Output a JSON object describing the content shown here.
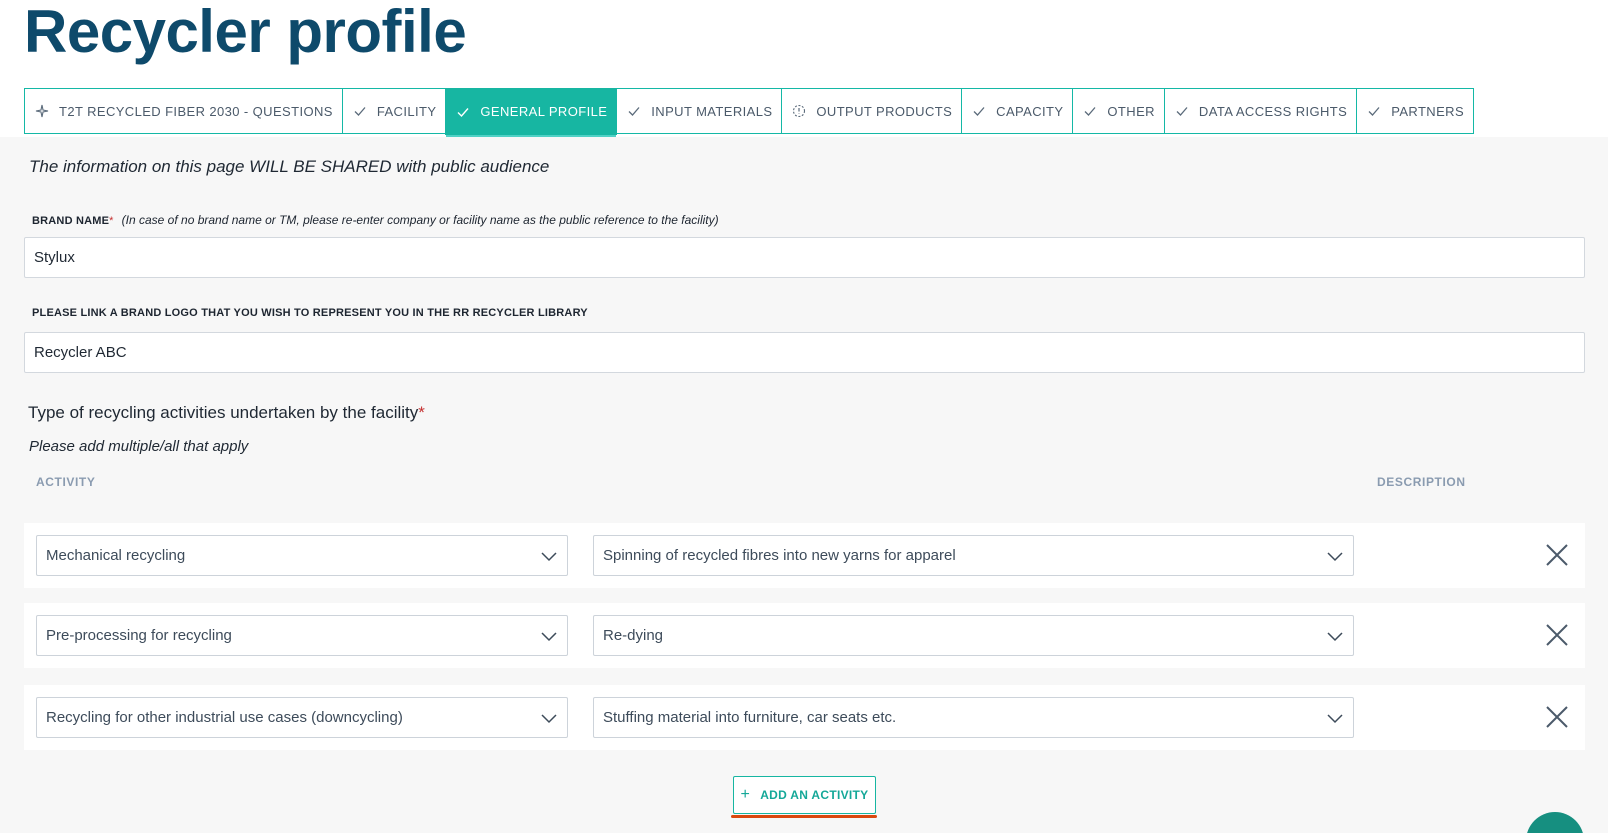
{
  "page": {
    "title": "Recycler profile"
  },
  "tabs": [
    {
      "label": "T2T RECYCLED FIBER 2030 - QUESTIONS",
      "icon": "sparkle-icon",
      "status": "special",
      "active": false
    },
    {
      "label": "FACILITY",
      "icon": "check-icon",
      "status": "complete",
      "active": false
    },
    {
      "label": "GENERAL PROFILE",
      "icon": "check-icon",
      "status": "complete",
      "active": true
    },
    {
      "label": "INPUT MATERIALS",
      "icon": "check-icon",
      "status": "complete",
      "active": false
    },
    {
      "label": "OUTPUT PRODUCTS",
      "icon": "pending-icon",
      "status": "pending",
      "active": false
    },
    {
      "label": "CAPACITY",
      "icon": "check-icon",
      "status": "complete",
      "active": false
    },
    {
      "label": "OTHER",
      "icon": "check-icon",
      "status": "complete",
      "active": false
    },
    {
      "label": "DATA ACCESS RIGHTS",
      "icon": "check-icon",
      "status": "complete",
      "active": false
    },
    {
      "label": "PARTNERS",
      "icon": "check-icon",
      "status": "complete",
      "active": false
    }
  ],
  "notice": "The information on this page WILL BE SHARED with public audience",
  "brand_name": {
    "label": "BRAND NAME",
    "required_mark": "*",
    "hint": "(In case of no brand name or TM, please re-enter company or facility name as the public reference to the facility)",
    "value": "Stylux"
  },
  "brand_logo": {
    "label": "PLEASE LINK A BRAND LOGO THAT YOU WISH TO REPRESENT YOU IN THE RR RECYCLER LIBRARY",
    "value": "Recycler ABC"
  },
  "activities": {
    "title": "Type of recycling activities undertaken by the facility",
    "required_mark": "*",
    "subtitle": "Please add multiple/all that apply",
    "column_activity": "ACTIVITY",
    "column_description": "DESCRIPTION",
    "rows": [
      {
        "activity": "Mechanical recycling",
        "description": "Spinning of recycled fibres into new yarns for apparel"
      },
      {
        "activity": "Pre-processing for recycling",
        "description": "Re-dying"
      },
      {
        "activity": "Recycling for other industrial use cases (downcycling)",
        "description": "Stuffing material into furniture, car seats etc."
      }
    ],
    "add_button_label": "ADD AN ACTIVITY",
    "add_button_icon": "+"
  },
  "colors": {
    "title": "#0e4a6b",
    "accent": "#17b6a2",
    "required": "#c53030",
    "focus_underline": "#d9480f"
  }
}
